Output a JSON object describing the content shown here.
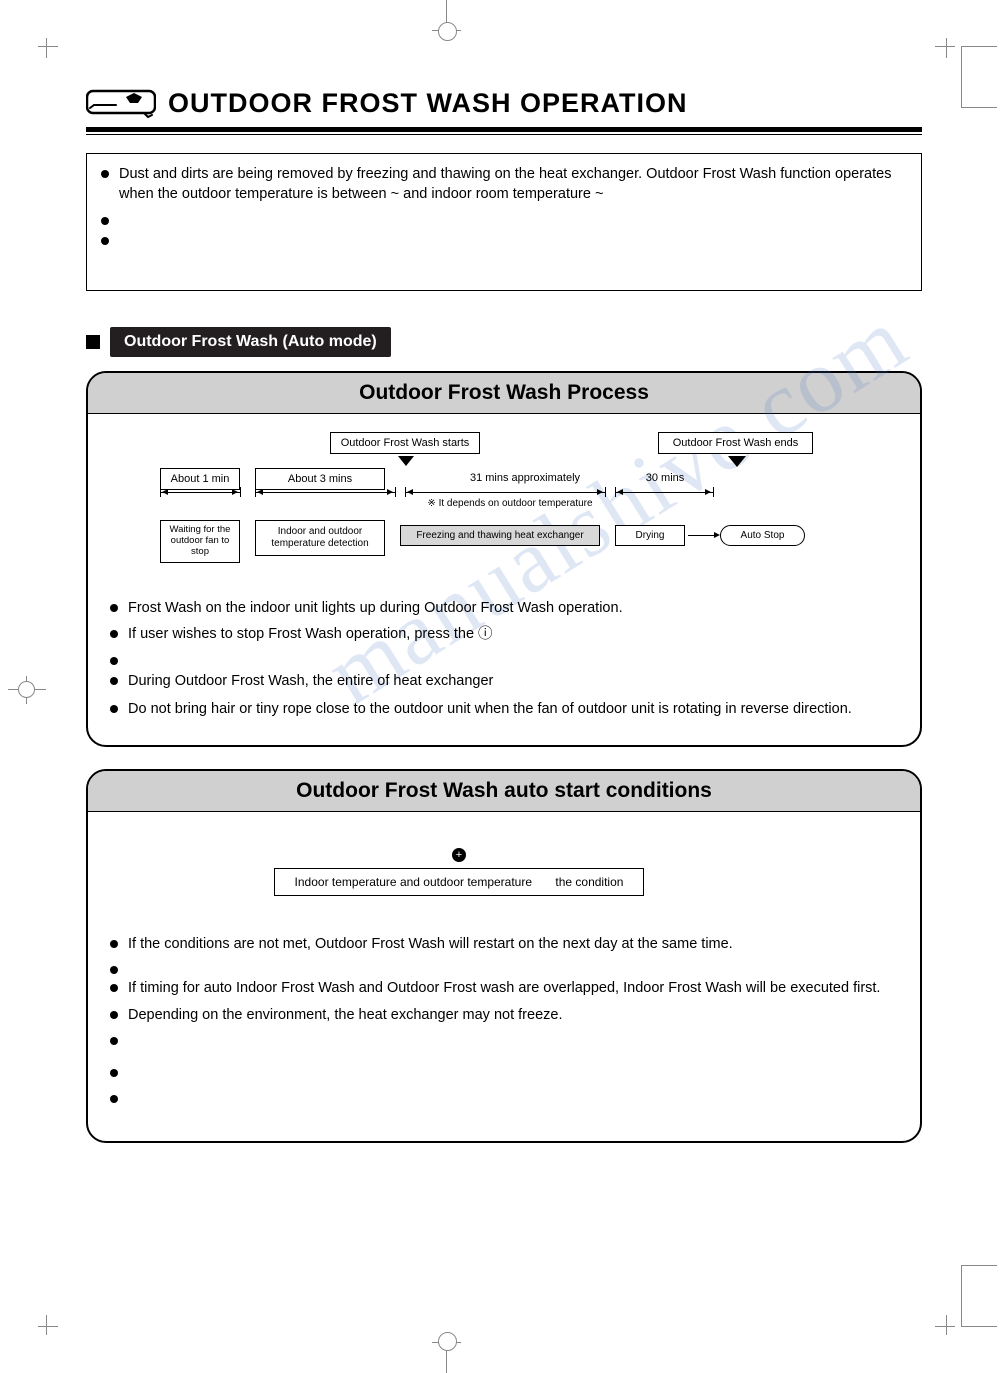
{
  "title": "OUTDOOR FROST WASH OPERATION",
  "watermark": "manualshive.com",
  "intro_bullets": [
    "Dust and dirts are being removed by freezing and thawing on the heat exchanger. Outdoor Frost Wash function operates when the outdoor temperature is between        ~         and indoor room temperature      ~",
    "",
    ""
  ],
  "section_header": "Outdoor Frost Wash (Auto mode)",
  "process_box": {
    "title": "Outdoor Frost Wash Process",
    "labels": {
      "starts": "Outdoor Frost Wash starts",
      "ends": "Outdoor Frost Wash ends",
      "about1min": "About 1 min",
      "about3mins": "About 3 mins",
      "approx31": "31 mins approximately",
      "depends": "※ It depends on outdoor temperature",
      "thirty": "30 mins",
      "waiting": "Waiting for the outdoor fan to stop",
      "detection": "Indoor and outdoor temperature detection",
      "freezing": "Freezing and thawing heat exchanger",
      "drying": "Drying",
      "autostop": "Auto Stop"
    },
    "bullets": [
      "Frost Wash             on the indoor unit lights up during Outdoor Frost Wash operation.",
      "If user wishes to stop Frost Wash operation, press the  ⓘ",
      "",
      "During Outdoor Frost Wash, the entire of heat exchanger",
      "Do not bring hair or tiny rope  close to the outdoor unit when the fan of outdoor unit is rotating in reverse direction."
    ]
  },
  "conditions_box": {
    "title": "Outdoor Frost Wash auto start conditions",
    "cond_left": "Indoor temperature and outdoor temperature",
    "cond_right": "the condition",
    "bullets": [
      "If the conditions are not met, Outdoor Frost Wash will restart on the next day at the same time.",
      "",
      "If timing for auto Indoor Frost Wash and Outdoor Frost wash are overlapped, Indoor Frost Wash will be executed first.",
      "Depending on the environment, the heat exchanger may not freeze.",
      "",
      "",
      ""
    ]
  }
}
